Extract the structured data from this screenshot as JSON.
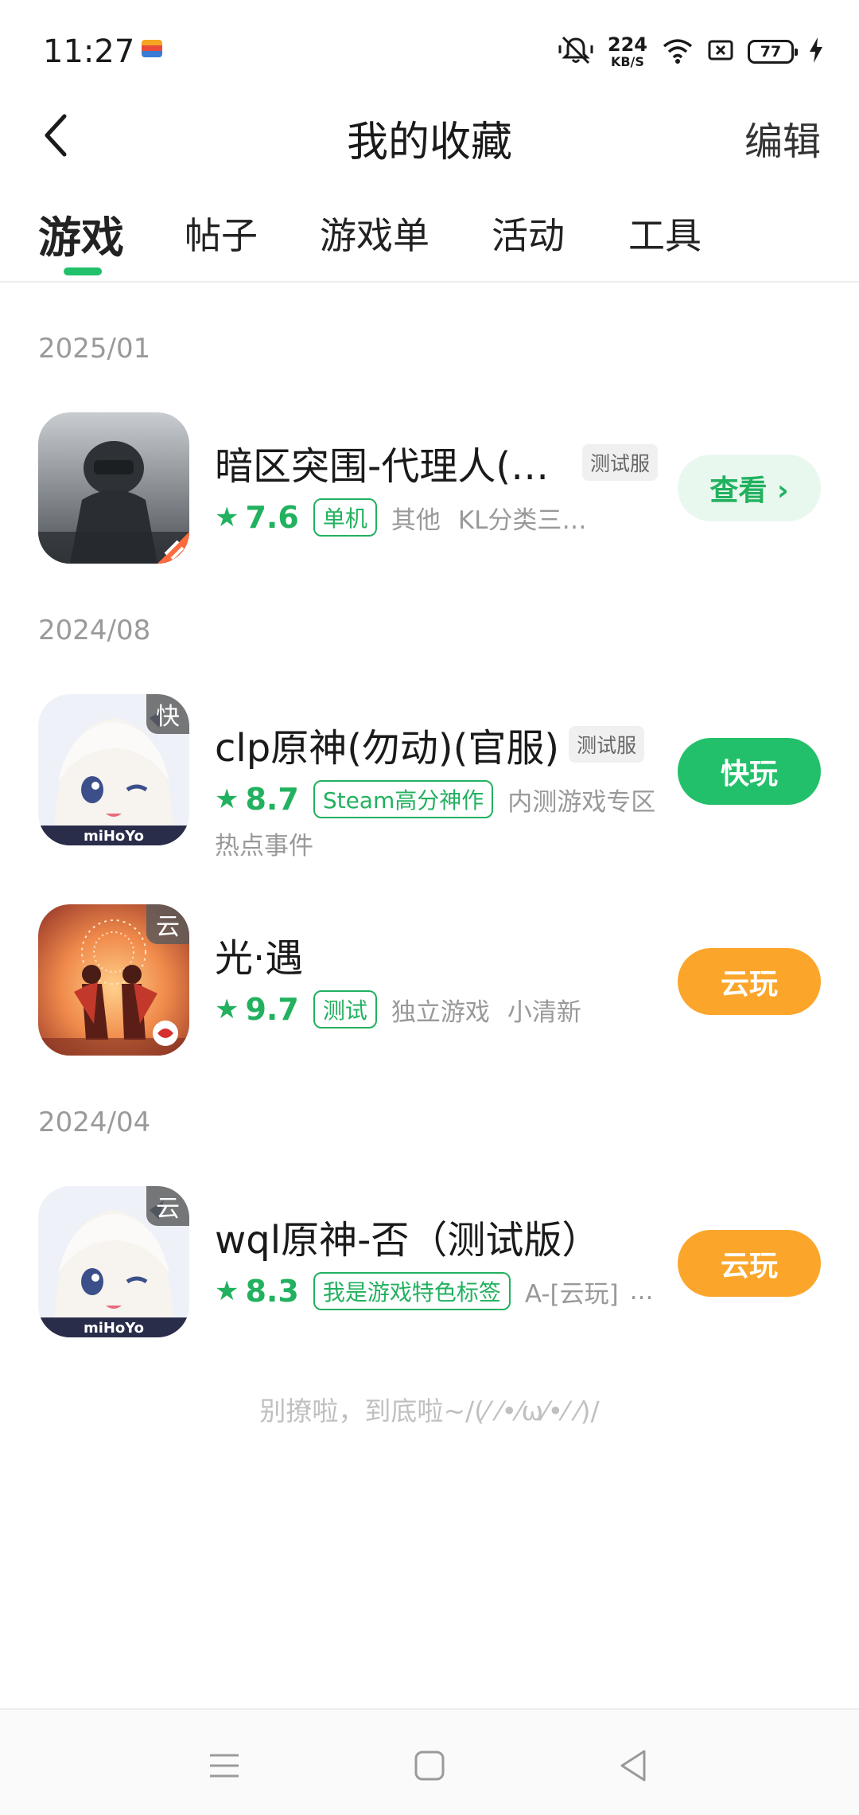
{
  "status_bar": {
    "time": "11:27",
    "net_speed_value": "224",
    "net_speed_unit": "KB/S",
    "battery": "77"
  },
  "header": {
    "title": "我的收藏",
    "edit_label": "编辑"
  },
  "tabs": [
    {
      "label": "游戏",
      "active": true
    },
    {
      "label": "帖子",
      "active": false
    },
    {
      "label": "游戏单",
      "active": false
    },
    {
      "label": "活动",
      "active": false
    },
    {
      "label": "工具",
      "active": false
    }
  ],
  "sections": [
    {
      "date": "2025/01",
      "games": [
        {
          "name": "暗区突围-代理人(官服)",
          "test_badge": "测试服",
          "score": "7.6",
          "tag": "单机",
          "meta": [
            "其他",
            "KL分类三转一零零"
          ],
          "button": "查看 ›"
        }
      ]
    },
    {
      "date": "2024/08",
      "games": [
        {
          "name": "clp原神(勿动)(官服)",
          "test_badge": "测试服",
          "corner_badge": "快",
          "score": "8.7",
          "tag": "Steam高分神作",
          "meta": [
            "内测游戏专区"
          ],
          "extra": "热点事件",
          "button": "快玩"
        },
        {
          "name": "光·遇",
          "corner_badge": "云",
          "score": "9.7",
          "tag": "测试",
          "meta": [
            "独立游戏",
            "小清新"
          ],
          "button": "云玩"
        }
      ]
    },
    {
      "date": "2024/04",
      "games": [
        {
          "name": "wql原神-否（测试版）",
          "corner_badge": "云",
          "score": "8.3",
          "tag": "我是游戏特色标签",
          "meta": [
            "A-[云玩]",
            "..."
          ],
          "button": "云玩"
        }
      ]
    }
  ],
  "footer_note": "别撩啦，到底啦~/(⁄ ⁄•⁄ω⁄•⁄ ⁄)/",
  "icon_labels": {
    "game1_brand": "",
    "mihoyo": "miHoYo"
  },
  "colors": {
    "accent_green": "#22c06a",
    "cloud_orange": "#fba62b"
  }
}
